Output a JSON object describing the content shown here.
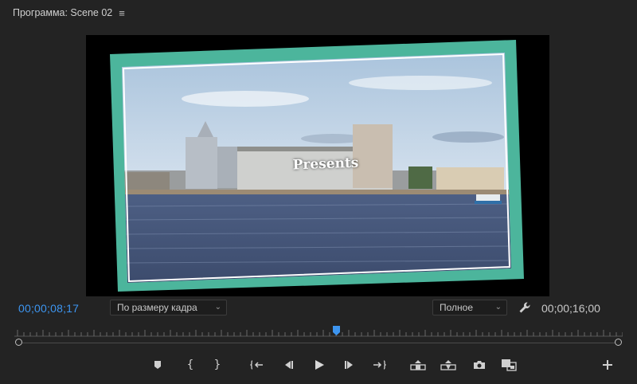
{
  "panel": {
    "title": "Программа: Scene 02",
    "menu_icon": "≡"
  },
  "viewer": {
    "overlay_title": "Presents",
    "frame_color": "#4cb59c"
  },
  "controls": {
    "current_timecode": "00;00;08;17",
    "duration_timecode": "00;00;16;00",
    "zoom_select": "По размеру кадра",
    "quality_select": "Полное",
    "accent_color": "#3d95f0"
  },
  "transport": {
    "buttons": [
      "add-marker-icon",
      "mark-in-icon",
      "mark-out-icon",
      "go-to-in-icon",
      "step-back-icon",
      "play-icon",
      "step-forward-icon",
      "go-to-out-icon",
      "lift-icon",
      "extract-icon",
      "export-frame-icon",
      "comparison-view-icon",
      "add-button-icon"
    ]
  }
}
